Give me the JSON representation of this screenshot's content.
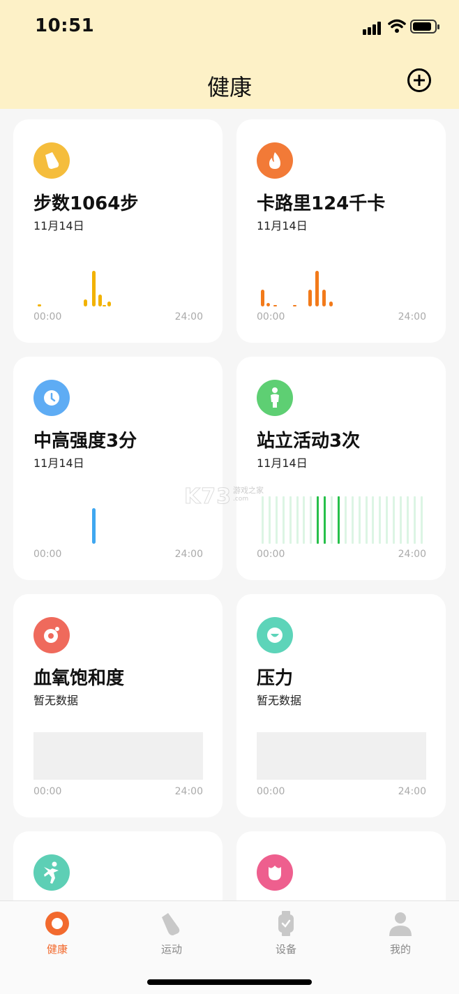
{
  "status_bar": {
    "time": "10:51"
  },
  "header": {
    "title": "健康"
  },
  "cards": [
    {
      "id": "steps",
      "title": "步数1064步",
      "subtitle": "11月14日",
      "icon": "shoe-icon",
      "icon_color": "#f5bd3c",
      "chart_color": "#f2b200",
      "time_start": "00:00",
      "time_end": "24:00",
      "bars": [
        0.05,
        0.15,
        0.75,
        0.25,
        0.03,
        0.1
      ]
    },
    {
      "id": "calories",
      "title": "卡路里124千卡",
      "subtitle": "11月14日",
      "icon": "flame-icon",
      "icon_color": "#f27a37",
      "chart_color": "#f27a1a",
      "time_start": "00:00",
      "time_end": "24:00",
      "bars": [
        0.35,
        0.07,
        0.03,
        0.03,
        0.35,
        0.75,
        0.35,
        0.1
      ]
    },
    {
      "id": "intensity",
      "title": "中高强度3分",
      "subtitle": "11月14日",
      "icon": "clock-icon",
      "icon_color": "#5eacf4",
      "chart_color": "#3fa7f0",
      "time_start": "00:00",
      "time_end": "24:00",
      "bars": [
        0.75
      ]
    },
    {
      "id": "standing",
      "title": "站立活动3次",
      "subtitle": "11月14日",
      "icon": "standing-person-icon",
      "icon_color": "#5ecf73",
      "chart_color": "#27c04a",
      "time_start": "00:00",
      "time_end": "24:00",
      "active_hours": [
        8,
        9,
        11
      ]
    },
    {
      "id": "spo2",
      "title": "血氧饱和度",
      "subtitle": "暂无数据",
      "icon": "blood-drop-icon",
      "icon_color": "#ef6a5c",
      "time_start": "00:00",
      "time_end": "24:00"
    },
    {
      "id": "stress",
      "title": "压力",
      "subtitle": "暂无数据",
      "icon": "smile-icon",
      "icon_color": "#5dd4b9",
      "time_start": "00:00",
      "time_end": "24:00"
    },
    {
      "id": "workout",
      "icon": "runner-icon",
      "icon_color": "#5dcfb5"
    },
    {
      "id": "cycle",
      "icon": "flower-icon",
      "icon_color": "#ee5f8e"
    }
  ],
  "watermark": {
    "text": "K73",
    "small": "游戏之家",
    "url": ".com"
  },
  "tab_bar": {
    "tabs": [
      {
        "label": "健康",
        "icon": "health-ring-icon",
        "active": true
      },
      {
        "label": "运动",
        "icon": "shoe-icon",
        "active": false
      },
      {
        "label": "设备",
        "icon": "watch-icon",
        "active": false
      },
      {
        "label": "我的",
        "icon": "person-icon",
        "active": false
      }
    ]
  }
}
